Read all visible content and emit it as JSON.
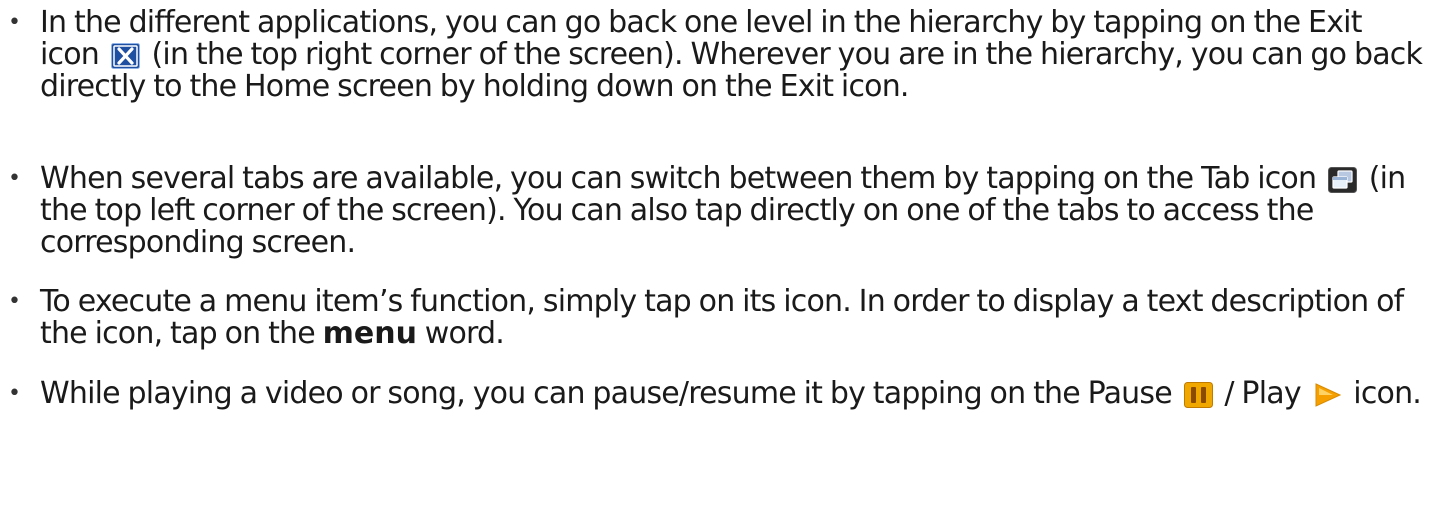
{
  "items": [
    {
      "a": "In the different applications, you can go back one level in the hierarchy by tapping on the Exit icon",
      "b": "(in the top right corner of the screen). Wherever you are in the hierarchy, you can go back directly to the Home screen by holding down on the Exit icon."
    },
    {
      "a": "When several tabs are available, you can switch between them by tapping on the Tab icon",
      "b": "(in the top left corner of the screen). You can also tap directly on one of the tabs to access the corresponding screen."
    },
    {
      "a": "To execute a menu item’s function, simply tap on its icon. In order to display a text description of the icon, tap on the",
      "kw": "menu",
      "b": "word."
    },
    {
      "a": "While playing a video or song, you can pause/resume it by tapping on the Pause",
      "b": "/ Play",
      "c": "icon."
    }
  ],
  "icons": {
    "exit": "close-icon",
    "tab": "tab-icon",
    "pause": "pause-icon",
    "play": "play-icon"
  },
  "colors": {
    "exit_bg": "#1f4fa0",
    "tab_bg": "#2a2a2a",
    "pause_bg": "#f0a800",
    "play_bg": "#f5a000"
  }
}
